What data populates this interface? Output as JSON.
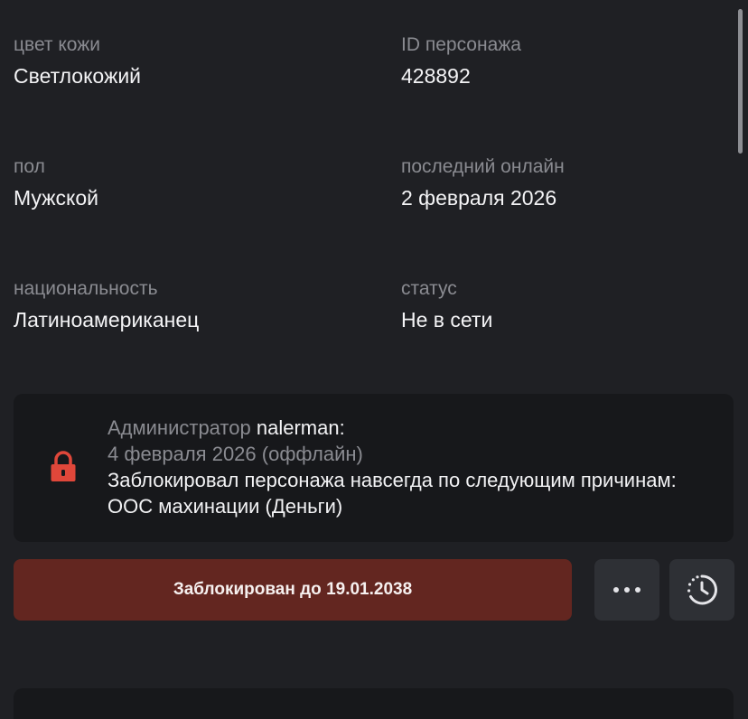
{
  "fields": {
    "skin_color": {
      "label": "цвет кожи",
      "value": "Светлокожий"
    },
    "character_id": {
      "label": "ID персонажа",
      "value": "428892"
    },
    "gender": {
      "label": "пол",
      "value": "Мужской"
    },
    "last_online": {
      "label": "последний онлайн",
      "value": "2 февраля 2026"
    },
    "nationality": {
      "label": "национальность",
      "value": "Латиноамериканец"
    },
    "status": {
      "label": "статус",
      "value": "Не в сети"
    }
  },
  "ban_notice": {
    "icon": "lock-icon",
    "admin_prefix": "Администратор",
    "admin_name": "nalerman:",
    "date": "4 февраля 2026 (оффлайн)",
    "reason": "Заблокировал персонажа навсегда по следующим причинам: ООС махинации (Деньги)"
  },
  "actions": {
    "ban_button_label": "Заблокирован до 19.01.2038",
    "more_icon": "more-dots-icon",
    "history_icon": "history-icon"
  },
  "colors": {
    "background": "#1f2024",
    "card": "#17181b",
    "ban_button": "#632620",
    "lock_red": "#e0473a",
    "muted_text": "#8a8b91"
  }
}
